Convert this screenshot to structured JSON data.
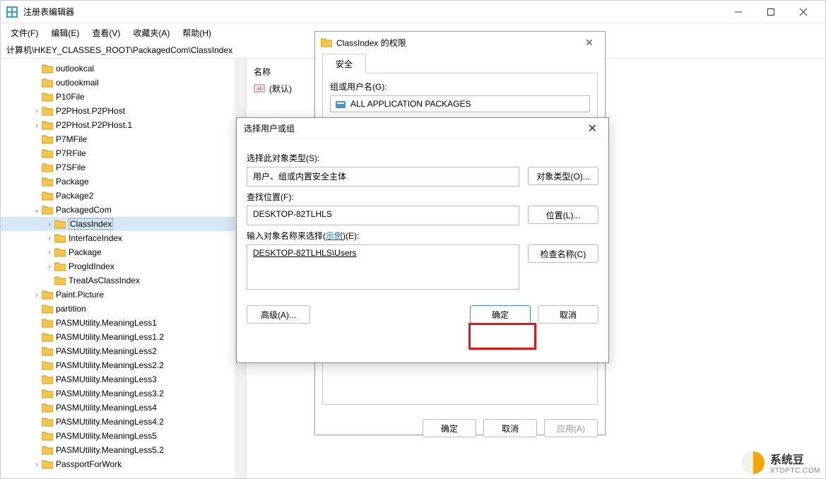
{
  "window": {
    "title": "注册表编辑器"
  },
  "menu": {
    "file": "文件(F)",
    "edit": "编辑(E)",
    "view": "查看(V)",
    "favorites": "收藏夹(A)",
    "help": "帮助(H)"
  },
  "addressbar": "计算机\\HKEY_CLASSES_ROOT\\PackagedCom\\ClassIndex",
  "tree": [
    {
      "label": "outlookcal",
      "depth": 2,
      "expander": ""
    },
    {
      "label": "outlookmail",
      "depth": 2,
      "expander": ""
    },
    {
      "label": "P10File",
      "depth": 2,
      "expander": ""
    },
    {
      "label": "P2PHost.P2PHost",
      "depth": 2,
      "expander": ">"
    },
    {
      "label": "P2PHost.P2PHost.1",
      "depth": 2,
      "expander": ">"
    },
    {
      "label": "P7MFile",
      "depth": 2,
      "expander": ""
    },
    {
      "label": "P7RFile",
      "depth": 2,
      "expander": ""
    },
    {
      "label": "P7SFile",
      "depth": 2,
      "expander": ""
    },
    {
      "label": "Package",
      "depth": 2,
      "expander": ""
    },
    {
      "label": "Package2",
      "depth": 2,
      "expander": ""
    },
    {
      "label": "PackagedCom",
      "depth": 2,
      "expander": "v"
    },
    {
      "label": "ClassIndex",
      "depth": 3,
      "expander": ">",
      "selected": true
    },
    {
      "label": "InterfaceIndex",
      "depth": 3,
      "expander": ">"
    },
    {
      "label": "Package",
      "depth": 3,
      "expander": ">"
    },
    {
      "label": "ProgIdIndex",
      "depth": 3,
      "expander": ">"
    },
    {
      "label": "TreatAsClassIndex",
      "depth": 3,
      "expander": ""
    },
    {
      "label": "Paint.Picture",
      "depth": 2,
      "expander": ">"
    },
    {
      "label": "partition",
      "depth": 2,
      "expander": ""
    },
    {
      "label": "PASMUtility.MeaningLess1",
      "depth": 2,
      "expander": ""
    },
    {
      "label": "PASMUtility.MeaningLess1.2",
      "depth": 2,
      "expander": ""
    },
    {
      "label": "PASMUtility.MeaningLess2",
      "depth": 2,
      "expander": ""
    },
    {
      "label": "PASMUtility.MeaningLess2.2",
      "depth": 2,
      "expander": ""
    },
    {
      "label": "PASMUtility.MeaningLess3",
      "depth": 2,
      "expander": ""
    },
    {
      "label": "PASMUtility.MeaningLess3.2",
      "depth": 2,
      "expander": ""
    },
    {
      "label": "PASMUtility.MeaningLess4",
      "depth": 2,
      "expander": ""
    },
    {
      "label": "PASMUtility.MeaningLess4.2",
      "depth": 2,
      "expander": ""
    },
    {
      "label": "PASMUtility.MeaningLess5",
      "depth": 2,
      "expander": ""
    },
    {
      "label": "PASMUtility.MeaningLess5.2",
      "depth": 2,
      "expander": ""
    },
    {
      "label": "PassportForWork",
      "depth": 2,
      "expander": ">"
    }
  ],
  "list": {
    "header_name": "名称",
    "default_name": "(默认)"
  },
  "perm_dialog": {
    "title": "ClassIndex 的权限",
    "tab_security": "安全",
    "group_label": "组或用户名(G):",
    "group_item": "ALL APPLICATION PACKAGES",
    "ok": "确定",
    "cancel": "取消",
    "apply": "应用(A)"
  },
  "select_dialog": {
    "title": "选择用户或组",
    "obj_type_label": "选择此对象类型(S):",
    "obj_type_value": "用户、组或内置安全主体",
    "obj_type_btn": "对象类型(O)...",
    "location_label": "查找位置(F):",
    "location_value": "DESKTOP-82TLHLS",
    "location_btn": "位置(L)...",
    "enter_label_pre": "输入对象名称来选择(",
    "enter_label_link": "示例",
    "enter_label_post": ")(E):",
    "enter_value": "DESKTOP-82TLHLS\\Users",
    "check_btn": "检查名称(C)",
    "advanced_btn": "高级(A)...",
    "ok": "确定",
    "cancel": "取消"
  },
  "watermark": {
    "name": "系统豆",
    "url": "XTDPTC.COM"
  }
}
